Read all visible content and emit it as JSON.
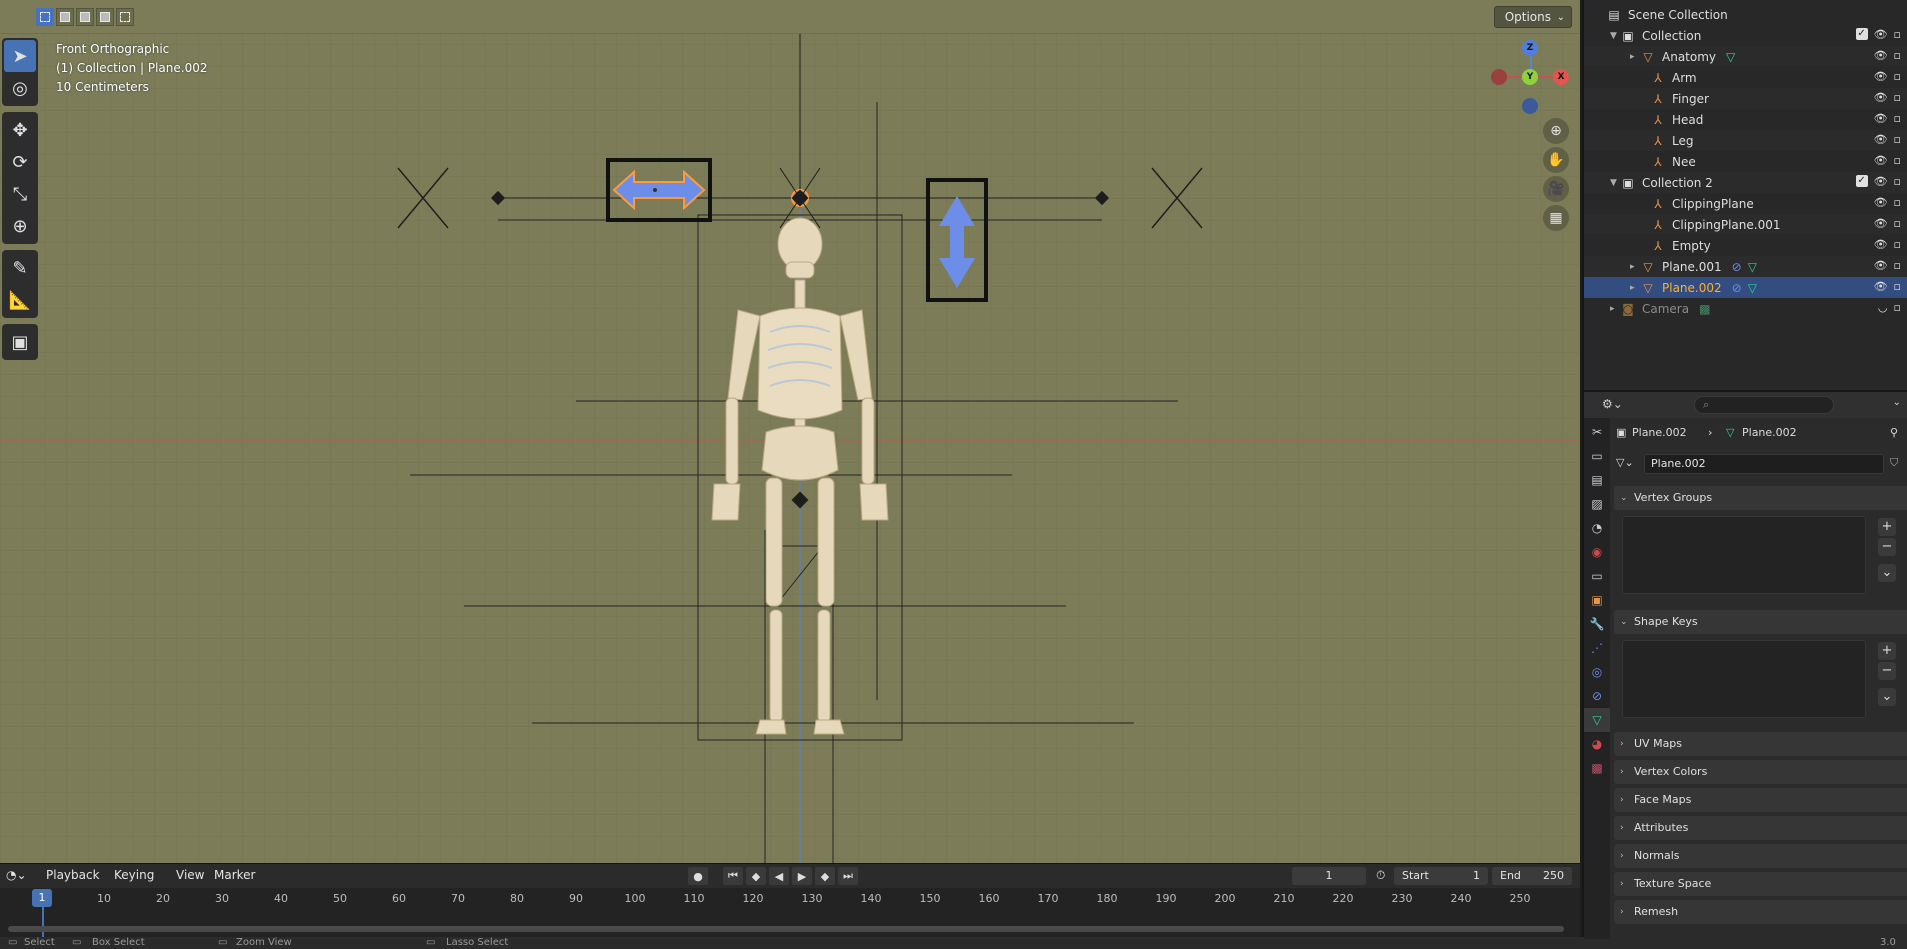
{
  "viewport": {
    "view_name": "Front Orthographic",
    "context": "(1) Collection | Plane.002",
    "scale": "10 Centimeters",
    "options_label": "Options",
    "gizmo": {
      "z": "Z",
      "y": "Y",
      "x": "X"
    }
  },
  "timeline": {
    "menus": [
      "Playback",
      "Keying",
      "View",
      "Marker"
    ],
    "current_frame": "1",
    "start_label": "Start",
    "start_value": "1",
    "end_label": "End",
    "end_value": "250",
    "ruler": [
      "10",
      "20",
      "30",
      "40",
      "50",
      "60",
      "70",
      "80",
      "90",
      "100",
      "110",
      "120",
      "130",
      "140",
      "150",
      "160",
      "170",
      "180",
      "190",
      "200",
      "210",
      "220",
      "230",
      "240",
      "250"
    ],
    "ruler_current": "1"
  },
  "statusbar": {
    "select": "Select",
    "box_select": "Box Select",
    "zoom_view": "Zoom View",
    "lasso_select": "Lasso Select",
    "version": "3.0"
  },
  "outliner": {
    "scene_collection": "Scene Collection",
    "items": [
      {
        "label": "Collection",
        "level": 1,
        "icon": "collection-icon",
        "tri": "▼"
      },
      {
        "label": "Anatomy",
        "level": 2,
        "icon": "mesh-icon",
        "tri": "▸"
      },
      {
        "label": "Arm",
        "level": 2,
        "icon": "armature-icon",
        "tri": ""
      },
      {
        "label": "Finger",
        "level": 2,
        "icon": "armature-icon",
        "tri": ""
      },
      {
        "label": "Head",
        "level": 2,
        "icon": "armature-icon",
        "tri": ""
      },
      {
        "label": "Leg",
        "level": 2,
        "icon": "armature-icon",
        "tri": ""
      },
      {
        "label": "Nee",
        "level": 2,
        "icon": "armature-icon",
        "tri": ""
      },
      {
        "label": "Collection 2",
        "level": 1,
        "icon": "collection-icon",
        "tri": "▼"
      },
      {
        "label": "ClippingPlane",
        "level": 2,
        "icon": "armature-icon",
        "tri": ""
      },
      {
        "label": "ClippingPlane.001",
        "level": 2,
        "icon": "armature-icon",
        "tri": ""
      },
      {
        "label": "Empty",
        "level": 2,
        "icon": "armature-icon",
        "tri": ""
      },
      {
        "label": "Plane.001",
        "level": 2,
        "icon": "mesh-icon",
        "tri": "▸"
      },
      {
        "label": "Plane.002",
        "level": 2,
        "icon": "mesh-icon",
        "tri": "▸"
      },
      {
        "label": "Camera",
        "level": 1,
        "icon": "camera-icon",
        "tri": "▸"
      }
    ]
  },
  "properties": {
    "breadcrumb_object": "Plane.002",
    "breadcrumb_data": "Plane.002",
    "mesh_name": "Plane.002",
    "panels": {
      "vertex_groups": "Vertex Groups",
      "shape_keys": "Shape Keys",
      "uv_maps": "UV Maps",
      "vertex_colors": "Vertex Colors",
      "face_maps": "Face Maps",
      "attributes": "Attributes",
      "normals": "Normals",
      "texture_space": "Texture Space",
      "remesh": "Remesh"
    }
  },
  "colors": {
    "viewport_bg": "#7c7d58",
    "selection_blue": "#4772b3",
    "active_orange": "#ffaf29",
    "arrow_blue": "#6d8ee8"
  }
}
